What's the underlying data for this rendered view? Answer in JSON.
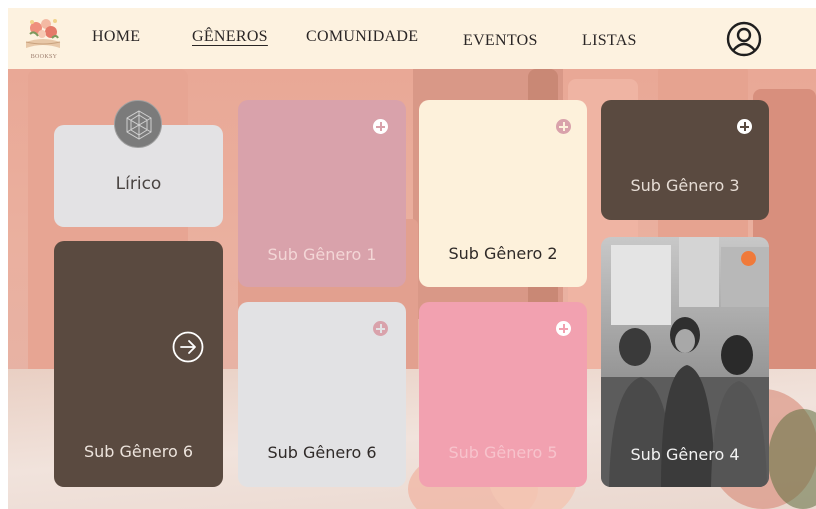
{
  "brand": {
    "logo_text": "BOOKSY"
  },
  "nav": {
    "items": [
      {
        "label": "HOME",
        "active": false
      },
      {
        "label": "GÊNEROS",
        "active": true
      },
      {
        "label": "COMUNIDADE",
        "active": false
      },
      {
        "label": "EVENTOS",
        "active": false
      },
      {
        "label": "LISTAS",
        "active": false
      }
    ],
    "profile_icon": "user-circle-icon"
  },
  "genre": {
    "label": "Lírico",
    "icon": "geometric-emblem-icon"
  },
  "cards": [
    {
      "label": "Sub Gênero 1",
      "color": "#d9a2ab",
      "text_color": "#f3d6d6",
      "icon": "plus-circle-icon"
    },
    {
      "label": "Sub Gênero 2",
      "color": "#fdf1db",
      "text_color": "#2f2a28",
      "icon": "plus-circle-icon"
    },
    {
      "label": "Sub Gênero 3",
      "color": "#5a4a40",
      "text_color": "#e6dcd4",
      "icon": "plus-circle-icon"
    },
    {
      "label": "Sub Gênero 6",
      "color": "#5a4a40",
      "text_color": "#ece3dc",
      "icon": "arrow-right-circle-icon"
    },
    {
      "label": "Sub Gênero 6",
      "color": "#e2e2e4",
      "text_color": "#2f2a28",
      "icon": "plus-circle-icon"
    },
    {
      "label": "Sub Gênero 5",
      "color": "#f2a1b0",
      "text_color": "#f7c3cc",
      "icon": "plus-circle-icon"
    },
    {
      "label": "Sub Gênero 4",
      "color": "#6a6a6a",
      "text_color": "#f2f2f2",
      "icon": "minus-circle-icon"
    }
  ],
  "colors": {
    "nav_bg": "#fdf2e0",
    "accent_orange": "#f07a3a",
    "genre_card": "#e3e2e4"
  }
}
